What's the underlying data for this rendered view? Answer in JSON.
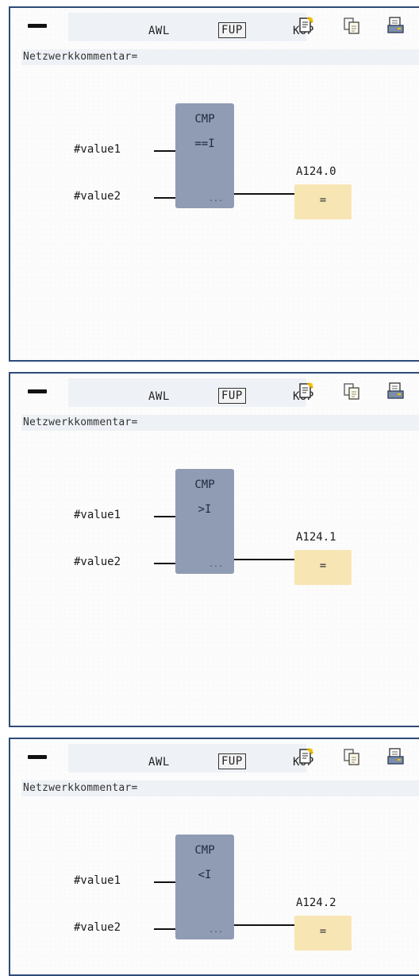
{
  "toolbar": {
    "tabs": [
      "AWL",
      "FUP",
      "KOP"
    ],
    "active_tab": "FUP",
    "icons": [
      "document-edit-icon",
      "copy-icon",
      "print-icon"
    ]
  },
  "networks": [
    {
      "comment_label": "Netzwerkkommentar=",
      "block_title": "CMP",
      "operator": "==I",
      "in1": "#value1",
      "in2": "#value2",
      "dots": "...",
      "output_address": "A124.0",
      "assign_symbol": "="
    },
    {
      "comment_label": "Netzwerkkommentar=",
      "block_title": "CMP",
      "operator": ">I",
      "in1": "#value1",
      "in2": "#value2",
      "dots": "...",
      "output_address": "A124.1",
      "assign_symbol": "="
    },
    {
      "comment_label": "Netzwerkkommentar=",
      "block_title": "CMP",
      "operator": "<I",
      "in1": "#value1",
      "in2": "#value2",
      "dots": "...",
      "output_address": "A124.2",
      "assign_symbol": "="
    }
  ]
}
